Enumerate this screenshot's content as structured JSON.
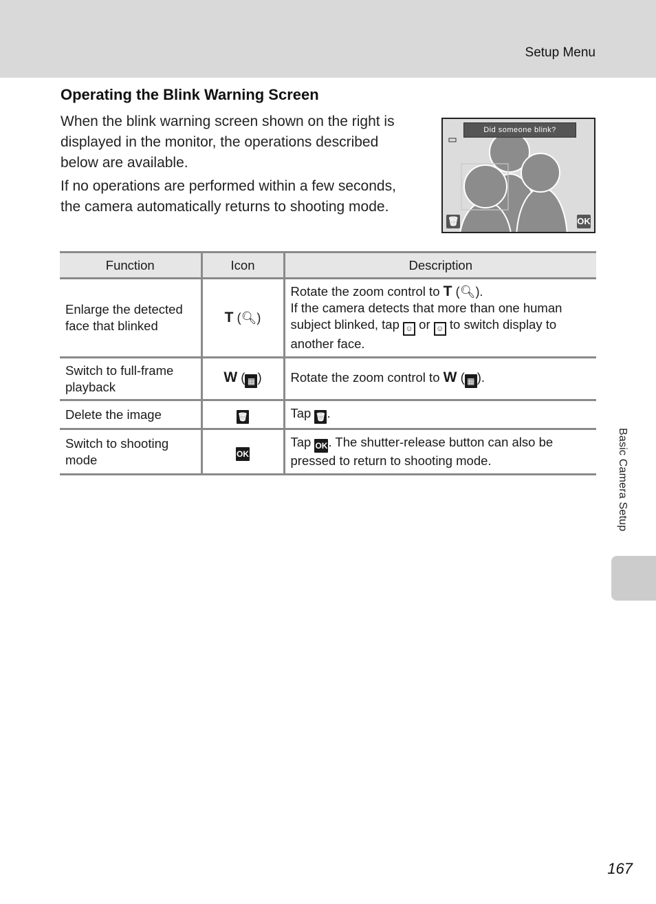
{
  "header": {
    "section": "Setup Menu"
  },
  "title": "Operating the Blink Warning Screen",
  "intro": [
    "When the blink warning screen shown on the right is displayed in the monitor, the operations described below are available.",
    "If no operations are performed within a few seconds, the camera automatically returns to shooting mode."
  ],
  "camera_screen": {
    "banner": "Did someone blink?",
    "left_button_icon": "trash-icon",
    "right_button": "OK"
  },
  "table": {
    "headers": [
      "Function",
      "Icon",
      "Description"
    ],
    "rows": [
      {
        "function": "Enlarge the detected face that blinked",
        "icon_letter": "T",
        "icon_symbol": "magnify-icon",
        "desc_line1_prefix": "Rotate the zoom control to",
        "desc_line1_letter": "T",
        "desc_line2_a": "If the camera detects that more than one human subject blinked, tap",
        "desc_line2_or": "or",
        "desc_line2_b": "to switch display to another face."
      },
      {
        "function": "Switch to full-frame playback",
        "icon_letter": "W",
        "icon_symbol": "thumbnail-icon",
        "desc_prefix": "Rotate the zoom control to",
        "desc_letter": "W"
      },
      {
        "function": "Delete the image",
        "icon_symbol": "trash-icon",
        "desc_prefix": "Tap",
        "desc_suffix": "."
      },
      {
        "function": "Switch to shooting mode",
        "icon_symbol": "ok-icon",
        "ok_label": "OK",
        "desc_prefix": "Tap",
        "desc_suffix": ". The shutter-release button can also be pressed to return to shooting mode."
      }
    ]
  },
  "side_tab": {
    "label": "Basic Camera Setup"
  },
  "page_number": "167"
}
